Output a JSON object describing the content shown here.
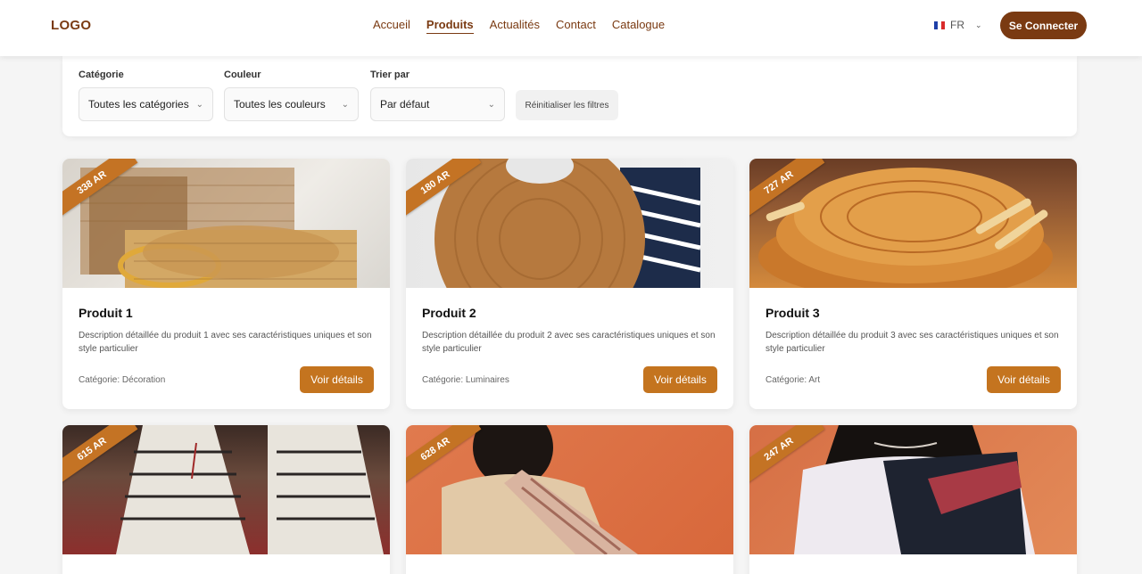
{
  "header": {
    "logo": "LOGO",
    "nav": [
      "Accueil",
      "Produits",
      "Actualités",
      "Contact",
      "Catalogue"
    ],
    "active_nav": "Produits",
    "language": "FR",
    "login_label": "Se Connecter"
  },
  "filters": {
    "category_label": "Catégorie",
    "category_value": "Toutes les catégories",
    "color_label": "Couleur",
    "color_value": "Toutes les couleurs",
    "sort_label": "Trier par",
    "sort_value": "Par défaut",
    "reset_label": "Réinitialiser les filtres"
  },
  "products": [
    {
      "price": "338 AR",
      "title": "Produit 1",
      "description": "Description détaillée du produit 1 avec ses caractéristiques uniques et son style particulier",
      "category": "Catégorie: Décoration",
      "button": "Voir détails"
    },
    {
      "price": "180 AR",
      "title": "Produit 2",
      "description": "Description détaillée du produit 2 avec ses caractéristiques uniques et son style particulier",
      "category": "Catégorie: Luminaires",
      "button": "Voir détails"
    },
    {
      "price": "727 AR",
      "title": "Produit 3",
      "description": "Description détaillée du produit 3 avec ses caractéristiques uniques et son style particulier",
      "category": "Catégorie: Art",
      "button": "Voir détails"
    },
    {
      "price": "615 AR"
    },
    {
      "price": "628 AR"
    },
    {
      "price": "247 AR"
    }
  ],
  "colors": {
    "brand": "#7a3a12",
    "accent": "#c4741f",
    "background": "#f5f5f5"
  }
}
